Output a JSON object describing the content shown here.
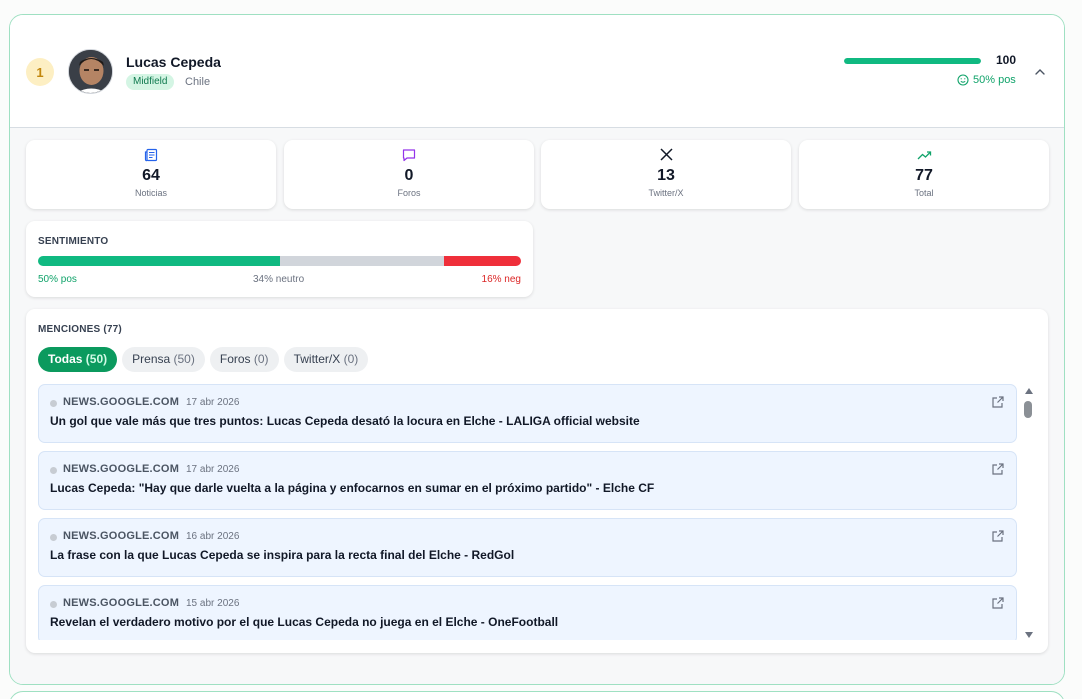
{
  "player": {
    "rank": "1",
    "name": "Lucas Cepeda",
    "position": "Midfield",
    "country": "Chile",
    "score": "100",
    "score_fraction": 1.0,
    "positive_summary": "50% pos"
  },
  "stats": [
    {
      "icon": "newspaper-icon",
      "value": "64",
      "label": "Noticias",
      "color": "#2563eb"
    },
    {
      "icon": "chat-bubble-icon",
      "value": "0",
      "label": "Foros",
      "color": "#9333ea"
    },
    {
      "icon": "x-logo-icon",
      "value": "13",
      "label": "Twitter/X",
      "color": "#111827"
    },
    {
      "icon": "trending-up-icon",
      "value": "77",
      "label": "Total",
      "color": "#10a36a"
    }
  ],
  "sentiment": {
    "title": "SENTIMIENTO",
    "positive": 50,
    "neutral": 34,
    "negative": 16,
    "positive_label": "50% pos",
    "neutral_label": "34% neutro",
    "negative_label": "16% neg",
    "colors": {
      "positive": "#10b981",
      "neutral": "#d1d5db",
      "negative": "#ef2f3a"
    }
  },
  "mentions": {
    "title": "MENCIONES (77)",
    "tabs": [
      {
        "label": "Todas",
        "count": "(50)",
        "active": true
      },
      {
        "label": "Prensa",
        "count": "(50)",
        "active": false
      },
      {
        "label": "Foros",
        "count": "(0)",
        "active": false
      },
      {
        "label": "Twitter/X",
        "count": "(0)",
        "active": false
      }
    ],
    "items": [
      {
        "source": "NEWS.GOOGLE.COM",
        "date": "17 abr 2026",
        "title": "Un gol que vale más que tres puntos: Lucas Cepeda desató la locura en Elche - LALIGA official website"
      },
      {
        "source": "NEWS.GOOGLE.COM",
        "date": "17 abr 2026",
        "title": "Lucas Cepeda: \"Hay que darle vuelta a la página y enfocarnos en sumar en el próximo partido\" - Elche CF"
      },
      {
        "source": "NEWS.GOOGLE.COM",
        "date": "16 abr 2026",
        "title": "La frase con la que Lucas Cepeda se inspira para la recta final del Elche - RedGol"
      },
      {
        "source": "NEWS.GOOGLE.COM",
        "date": "15 abr 2026",
        "title": "Revelan el verdadero motivo por el que Lucas Cepeda no juega en el Elche - OneFootball"
      }
    ]
  },
  "accent_color": "#10b981"
}
